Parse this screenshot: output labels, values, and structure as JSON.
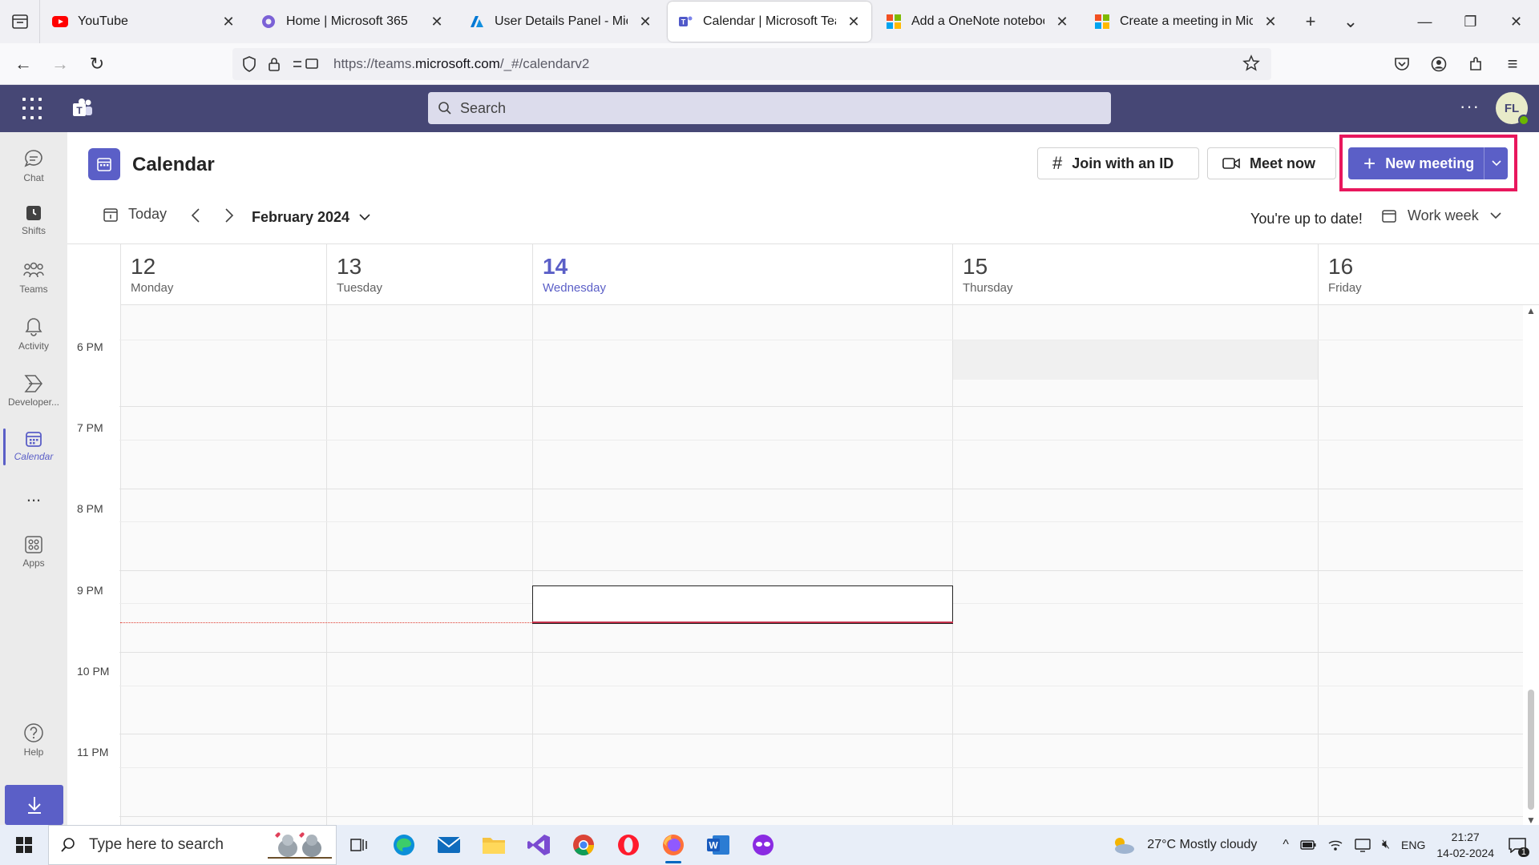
{
  "browser": {
    "tabs": [
      {
        "title": "YouTube",
        "icon": "youtube-icon",
        "active": false
      },
      {
        "title": "Home | Microsoft 365",
        "icon": "m365-icon",
        "active": false
      },
      {
        "title": "User Details Panel - Microso",
        "icon": "azure-icon",
        "active": false
      },
      {
        "title": "Calendar | Microsoft Teams",
        "icon": "teams-icon",
        "active": true
      },
      {
        "title": "Add a OneNote notebook in",
        "icon": "microsoft-icon",
        "active": false
      },
      {
        "title": "Create a meeting in Microso",
        "icon": "microsoft-icon",
        "active": false
      }
    ],
    "url_prefix": "https://teams.",
    "url_domain": "microsoft.com",
    "url_path": "/_#/calendarv2"
  },
  "teams_header": {
    "search_placeholder": "Search",
    "avatar_initials": "FL"
  },
  "rail": {
    "items": [
      {
        "label": "Chat",
        "icon": "chat-icon"
      },
      {
        "label": "Shifts",
        "icon": "shifts-icon"
      },
      {
        "label": "Teams",
        "icon": "teams-people-icon"
      },
      {
        "label": "Activity",
        "icon": "bell-icon"
      },
      {
        "label": "Developer...",
        "icon": "developer-icon"
      },
      {
        "label": "Calendar",
        "icon": "calendar-icon",
        "active": true
      },
      {
        "label": "...",
        "icon": "more-icon"
      },
      {
        "label": "Apps",
        "icon": "apps-icon"
      },
      {
        "label": "Help",
        "icon": "help-icon"
      }
    ]
  },
  "calendar": {
    "title": "Calendar",
    "join_label": "Join with an ID",
    "meet_label": "Meet now",
    "new_meeting_label": "New meeting",
    "today_label": "Today",
    "month_label": "February 2024",
    "status": "You're up to date!",
    "view_label": "Work week",
    "days": [
      {
        "num": "12",
        "name": "Monday"
      },
      {
        "num": "13",
        "name": "Tuesday"
      },
      {
        "num": "14",
        "name": "Wednesday",
        "today": true
      },
      {
        "num": "15",
        "name": "Thursday"
      },
      {
        "num": "16",
        "name": "Friday"
      }
    ],
    "hours": [
      "6 PM",
      "7 PM",
      "8 PM",
      "9 PM",
      "10 PM",
      "11 PM"
    ]
  },
  "taskbar": {
    "search_placeholder": "Type here to search",
    "weather": "27°C  Mostly cloudy",
    "language": "ENG",
    "time": "21:27",
    "date": "14-02-2024",
    "notification_count": "1"
  },
  "colors": {
    "teams_purple": "#464775",
    "accent": "#5b5fc7",
    "highlight": "#e8175d"
  }
}
